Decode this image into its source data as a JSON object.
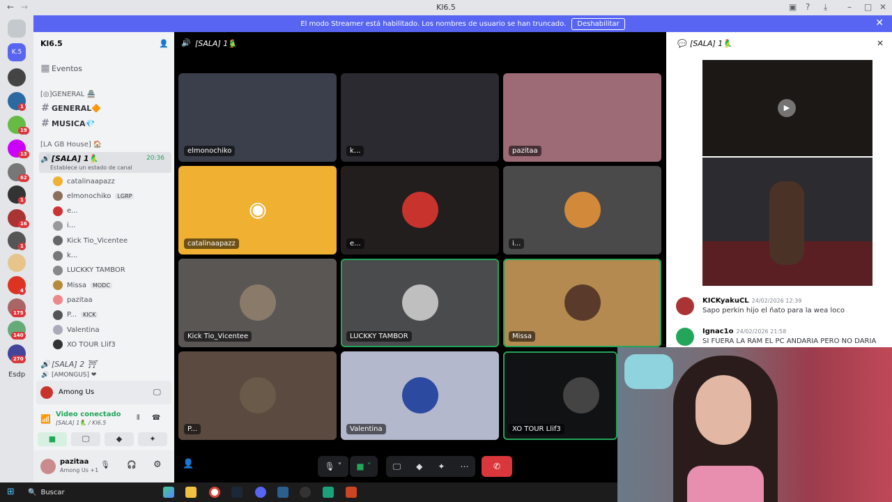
{
  "window": {
    "title": "Kl6.5",
    "back": "←",
    "forward": "→"
  },
  "banner": {
    "text": "El modo Streamer está habilitado. Los nombres de usuario se han truncado.",
    "button": "Deshabilitar"
  },
  "rail": {
    "servers": [
      {
        "label": "K.5",
        "color": "#5865f2",
        "badge": ""
      },
      {
        "label": "",
        "color": "#444",
        "badge": ""
      },
      {
        "label": "",
        "color": "#2b6aa0",
        "badge": "1"
      },
      {
        "label": "",
        "color": "#6b4",
        "badge": "19"
      },
      {
        "label": "",
        "color": "#c0f",
        "badge": "13"
      },
      {
        "label": "",
        "color": "#777",
        "badge": "62"
      },
      {
        "label": "",
        "color": "#333",
        "badge": "1"
      },
      {
        "label": "",
        "color": "#a33",
        "badge": "16"
      },
      {
        "label": "",
        "color": "#555",
        "badge": "1"
      },
      {
        "label": "",
        "color": "#e7c48a",
        "badge": ""
      },
      {
        "label": "",
        "color": "#d32",
        "badge": "4"
      },
      {
        "label": "",
        "color": "#a66",
        "badge": "175"
      },
      {
        "label": "",
        "color": "#6a7",
        "badge": "140"
      },
      {
        "label": "",
        "color": "#449",
        "badge": "270"
      }
    ],
    "bottom_label": "Esdp"
  },
  "sidebar": {
    "guild_name": "Kl6.5",
    "events": "Eventos",
    "cat1": "[◎]GENERAL 🏯",
    "general": "GENERAL🔶",
    "musica": "MUSICA💎",
    "cat2": "[LA GB House] 🏠",
    "voice_channel": "[SALA] 1🦜",
    "voice_time": "20:36",
    "voice_status": "Establece un estado de canal",
    "users": [
      {
        "name": "catalinaapazz",
        "color": "#f0b132",
        "tag": ""
      },
      {
        "name": "elmonochiko",
        "color": "#8b6f5a",
        "tag": "LGRP"
      },
      {
        "name": "e...",
        "color": "#c33",
        "tag": ""
      },
      {
        "name": "i...",
        "color": "#999",
        "tag": ""
      },
      {
        "name": "Kick Tio_Vicentee",
        "color": "#666",
        "tag": ""
      },
      {
        "name": "k...",
        "color": "#777",
        "tag": ""
      },
      {
        "name": "LUCKKY TAMBOR",
        "color": "#888",
        "tag": ""
      },
      {
        "name": "Missa",
        "color": "#b58a3c",
        "tag": "MODC"
      },
      {
        "name": "pazitaa",
        "color": "#e88",
        "tag": ""
      },
      {
        "name": "P...",
        "color": "#555",
        "tag": "KICK"
      },
      {
        "name": "Valentina",
        "color": "#aab",
        "tag": ""
      },
      {
        "name": "XO TOUR Llif3",
        "color": "#333",
        "tag": ""
      }
    ],
    "sala2": "[SALA] 2 ⛩",
    "among_cat": "[AMONGUS] ❤"
  },
  "voice_panel": {
    "game": "Among Us",
    "status": "Video conectado",
    "sub": "[SALA] 1🦜 / Kl6.5",
    "user": "pazitaa",
    "user_sub": "Among Us +1"
  },
  "stage": {
    "channel_title": "[SALA] 1🦜",
    "tiles": [
      {
        "name": "elmonochiko",
        "bg": "#3a3f4b",
        "speaking": false,
        "avatar": ""
      },
      {
        "name": "k...",
        "bg": "#2a2a30",
        "speaking": false,
        "avatar": ""
      },
      {
        "name": "pazitaa",
        "bg": "#9c6b75",
        "speaking": false,
        "avatar": ""
      },
      {
        "name": "catalinaapazz",
        "bg": "#f0b132",
        "speaking": false,
        "avatar": "#f0b132"
      },
      {
        "name": "e...",
        "bg": "#231e1e",
        "speaking": false,
        "avatar": "#c9332d"
      },
      {
        "name": "i...",
        "bg": "#4a4a4a",
        "speaking": false,
        "avatar": "#d28a3a"
      },
      {
        "name": "Kick Tio_Vicentee",
        "bg": "#5a5654",
        "speaking": false,
        "avatar": "#8a7a6a"
      },
      {
        "name": "LUCKKY TAMBOR",
        "bg": "#4a4b4d",
        "speaking": true,
        "avatar": "#bfbfbf"
      },
      {
        "name": "Missa",
        "bg": "#b58a50",
        "speaking": true,
        "avatar": "#5a3a2a"
      },
      {
        "name": "P...",
        "bg": "#5a4a40",
        "speaking": false,
        "avatar": "#6a5a4a"
      },
      {
        "name": "Valentina",
        "bg": "#b4b8cc",
        "speaking": false,
        "avatar": "#2c4aa0"
      },
      {
        "name": "XO TOUR Llif3",
        "bg": "#111214",
        "speaking": true,
        "avatar": "#444"
      }
    ]
  },
  "chat": {
    "header": "[SALA] 1🦜",
    "messages": [
      {
        "author": "KICKyakuCL",
        "time": "24/02/2026 12:39",
        "text": "Sapo perkin hijo el ñato para la wea loco",
        "color": "#a33"
      },
      {
        "author": "Ignac1o",
        "time": "24/02/2026 21:58",
        "text": "SI FUERA LA RAM EL PC ANDARIA PERO NO DARIA",
        "color": "#23a55a"
      }
    ]
  },
  "taskbar": {
    "search": "Buscar"
  },
  "icons": {
    "mic": "🎙",
    "camera": "📷",
    "screen": "🖵",
    "activities": "◆",
    "soundboard": "✦",
    "more": "⋯",
    "leave": "📞",
    "gear": "⚙",
    "headset": "🎧"
  }
}
